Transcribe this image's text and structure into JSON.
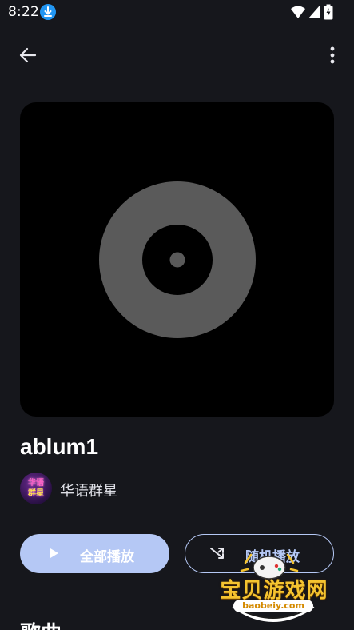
{
  "status_bar": {
    "time": "8:22",
    "icons": [
      "download-icon",
      "wifi-icon",
      "signal-icon",
      "battery-charging-icon"
    ]
  },
  "app_bar": {
    "back_icon": "arrow-left-icon",
    "more_icon": "more-vertical-icon"
  },
  "album": {
    "cover_placeholder_icon": "vinyl-disc-icon",
    "title": "ablum1",
    "artist": "华语群星",
    "artist_avatar_text": [
      "华语",
      "群星"
    ]
  },
  "actions": {
    "play_all_label": "全部播放",
    "shuffle_label": "随机播放"
  },
  "sections": {
    "songs_heading": "歌曲"
  },
  "watermark": {
    "text": "宝贝游戏网",
    "url": "baobeiy.com"
  },
  "colors": {
    "background": "#16171c",
    "accent": "#b5c8f5",
    "cover_bg": "#000000",
    "disc": "#5a5a5a"
  }
}
